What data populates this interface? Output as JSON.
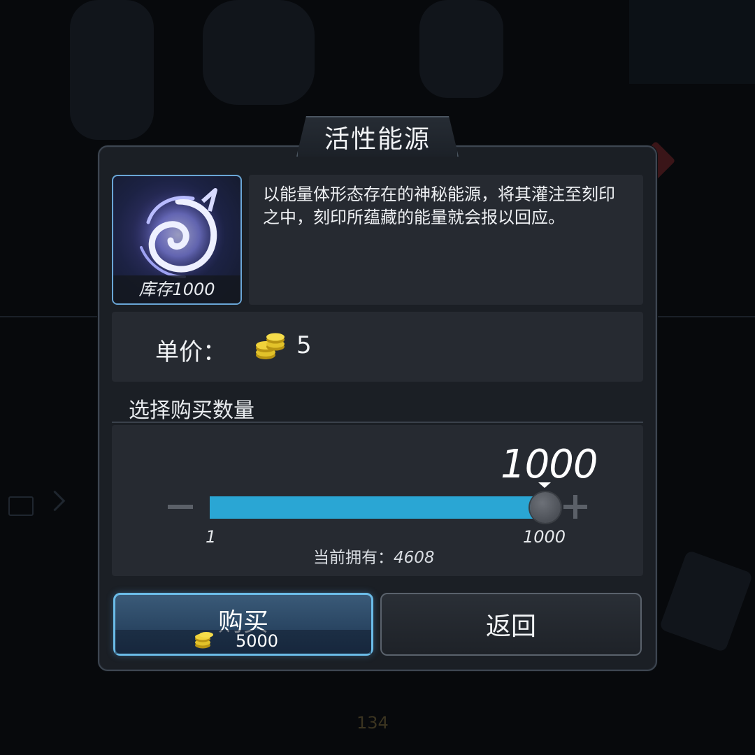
{
  "dialog": {
    "title": "活性能源",
    "item": {
      "icon": "energy-swirl-icon",
      "stock_label": "库存1000",
      "description": "以能量体形态存在的神秘能源，将其灌注至刻印之中，刻印所蕴藏的能量就会报以回应。"
    },
    "price": {
      "label": "单价：",
      "currency_icon": "gold-coin-stack-icon",
      "value": "5"
    },
    "quantity": {
      "section_label": "选择购买数量",
      "selected": "1000",
      "min_label": "1",
      "max_label": "1000",
      "fill_fraction": 1.0,
      "owned_text": "当前拥有：",
      "owned_value": "4608"
    },
    "buttons": {
      "buy_label": "购买",
      "buy_cost": "5000",
      "back_label": "返回"
    }
  },
  "background": {
    "bottom_number": "134"
  },
  "colors": {
    "accent_blue": "#2aa6d4",
    "buy_border": "#6bbce8",
    "panel": "#262a31",
    "dialog": "#1b1f25"
  }
}
